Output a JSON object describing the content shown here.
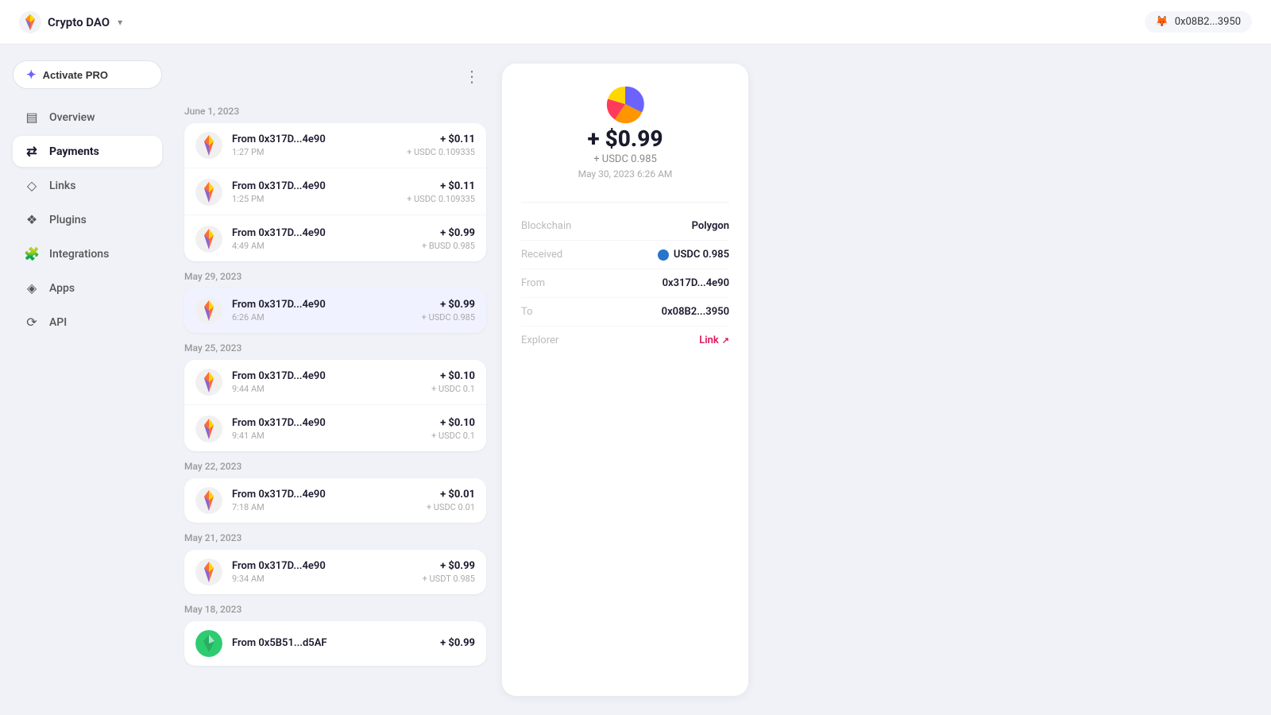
{
  "topbar": {
    "app_name": "Crypto DAO",
    "wallet_address": "0x08B2...3950",
    "wallet_emoji": "🦊"
  },
  "sidebar": {
    "activate_pro_label": "Activate PRO",
    "items": [
      {
        "id": "overview",
        "label": "Overview",
        "icon": "▤",
        "active": false
      },
      {
        "id": "payments",
        "label": "Payments",
        "icon": "⇄",
        "active": true
      },
      {
        "id": "links",
        "label": "Links",
        "icon": "◇",
        "active": false
      },
      {
        "id": "plugins",
        "label": "Plugins",
        "icon": "❖",
        "active": false
      },
      {
        "id": "integrations",
        "label": "Integrations",
        "icon": "🧩",
        "active": false
      },
      {
        "id": "apps",
        "label": "Apps",
        "icon": "◈",
        "active": false
      },
      {
        "id": "api",
        "label": "API",
        "icon": "⟳",
        "active": false
      }
    ]
  },
  "payments": {
    "groups": [
      {
        "date": "June 1, 2023",
        "items": [
          {
            "from": "From 0x317D...4e90",
            "time": "1:27 PM",
            "usd": "+ $0.11",
            "token": "+ USDC 0.109335",
            "selected": false
          },
          {
            "from": "From 0x317D...4e90",
            "time": "1:25 PM",
            "usd": "+ $0.11",
            "token": "+ USDC 0.109335",
            "selected": false
          },
          {
            "from": "From 0x317D...4e90",
            "time": "4:49 AM",
            "usd": "+ $0.99",
            "token": "+ BUSD 0.985",
            "selected": false
          }
        ]
      },
      {
        "date": "May 29, 2023",
        "items": [
          {
            "from": "From 0x317D...4e90",
            "time": "6:26 AM",
            "usd": "+ $0.99",
            "token": "+ USDC 0.985",
            "selected": true
          }
        ]
      },
      {
        "date": "May 25, 2023",
        "items": [
          {
            "from": "From 0x317D...4e90",
            "time": "9:44 AM",
            "usd": "+ $0.10",
            "token": "+ USDC 0.1",
            "selected": false
          },
          {
            "from": "From 0x317D...4e90",
            "time": "9:41 AM",
            "usd": "+ $0.10",
            "token": "+ USDC 0.1",
            "selected": false
          }
        ]
      },
      {
        "date": "May 22, 2023",
        "items": [
          {
            "from": "From 0x317D...4e90",
            "time": "7:18 AM",
            "usd": "+ $0.01",
            "token": "+ USDC 0.01",
            "selected": false
          }
        ]
      },
      {
        "date": "May 21, 2023",
        "items": [
          {
            "from": "From 0x317D...4e90",
            "time": "9:34 AM",
            "usd": "+ $0.99",
            "token": "+ USDT 0.985",
            "selected": false
          }
        ]
      },
      {
        "date": "May 18, 2023",
        "items": [
          {
            "from": "From 0x5B51...d5AF",
            "time": "",
            "usd": "+ $0.99",
            "token": "",
            "selected": false
          }
        ]
      }
    ]
  },
  "detail": {
    "amount": "+ $0.99",
    "token_label": "+ USDC 0.985",
    "date": "May 30, 2023 6:26 AM",
    "blockchain_key": "Blockchain",
    "blockchain_val": "Polygon",
    "received_key": "Received",
    "received_val": "USDC 0.985",
    "from_key": "From",
    "from_val": "0x317D...4e90",
    "to_key": "To",
    "to_val": "0x08B2...3950",
    "explorer_key": "Explorer",
    "explorer_val": "Link"
  }
}
